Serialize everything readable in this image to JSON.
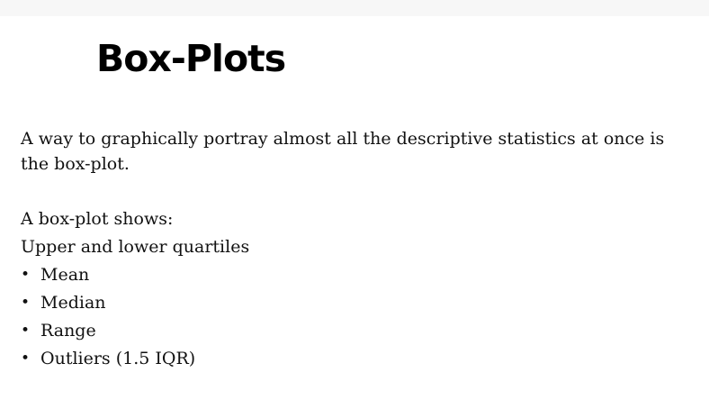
{
  "slide": {
    "title": "Box-Plots",
    "intro": "A way to graphically portray almost all the descriptive statistics at once is the box-plot.",
    "shows_heading": "A box-plot shows:",
    "first_item": "Upper and lower quartiles",
    "bullet_glyph": "•",
    "bullets": [
      "Mean",
      "Median",
      "Range",
      "Outliers (1.5 IQR)"
    ]
  }
}
